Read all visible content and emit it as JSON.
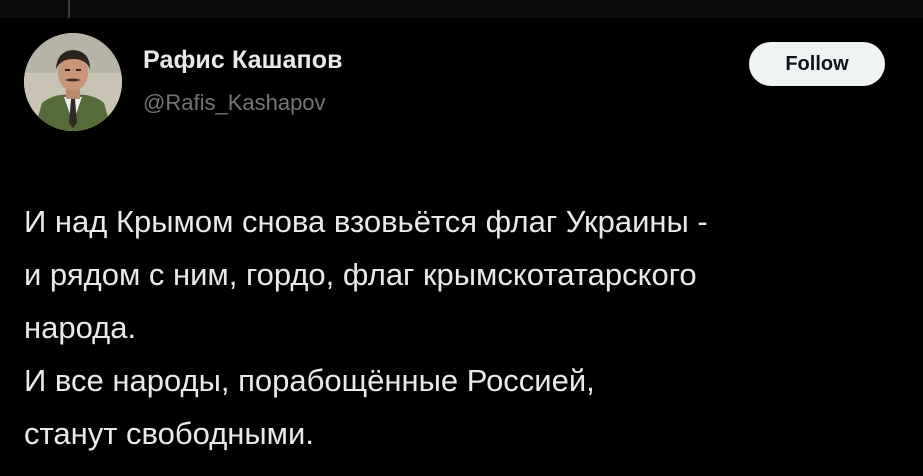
{
  "author": {
    "name": "Рафис Кашапов",
    "handle": "@Rafis_Kashapov",
    "avatar_icon": "profile-photo"
  },
  "follow_label": "Follow",
  "tweet": {
    "lines": [
      "И над Крымом снова взовьётся флаг Украины -",
      "и рядом с ним, гордо, флаг крымскотатарского",
      "народа.",
      "И все народы, порабощённые Россией,",
      "станут свободными."
    ]
  },
  "colors": {
    "background": "#000000",
    "text": "#e7e9ea",
    "secondary_text": "#71767b",
    "follow_button_bg": "#eff3f4",
    "follow_button_text": "#0f1419"
  }
}
